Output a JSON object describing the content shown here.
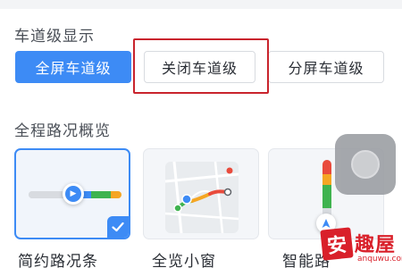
{
  "lane_display": {
    "title": "车道级显示",
    "options": [
      {
        "label": "全屏车道级",
        "selected": true
      },
      {
        "label": "关闭车道级",
        "selected": false
      },
      {
        "label": "分屏车道级",
        "selected": false
      }
    ]
  },
  "route_overview": {
    "title": "全程路况概览",
    "cards": [
      {
        "label": "简约路况条",
        "selected": true
      },
      {
        "label": "全览小窗",
        "selected": false
      },
      {
        "label": "智能路",
        "selected": false
      }
    ]
  },
  "watermark": {
    "badge": "安",
    "text": "趣屋",
    "url": "anquwu.com"
  },
  "colors": {
    "accent": "#3d8bf5",
    "traffic_green": "#3fb34f",
    "traffic_orange": "#f5a623",
    "traffic_red": "#e94b3c",
    "highlight_box": "#c9242d"
  }
}
